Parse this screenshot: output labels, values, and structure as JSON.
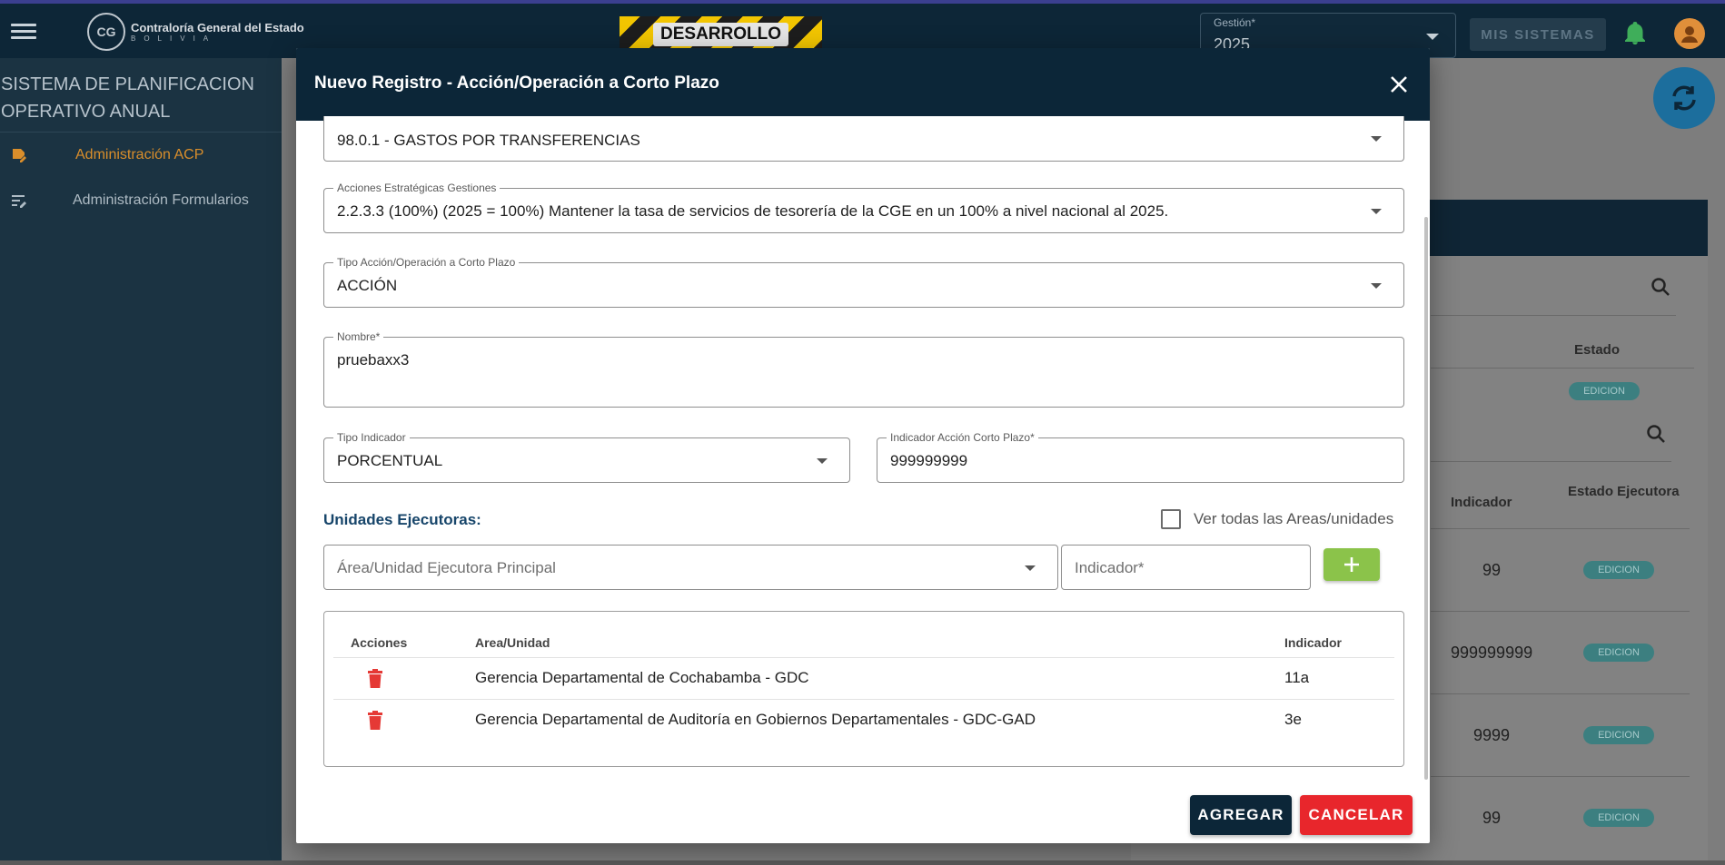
{
  "topbar": {
    "logo_text": "Contraloría General del Estado",
    "logo_sub": "BOLIVIA",
    "env_banner": "DESARROLLO",
    "gestion_label": "Gestión*",
    "gestion_value": "2025",
    "mis_sistemas": "MIS SISTEMAS"
  },
  "sidebar": {
    "system_title": "SISTEMA DE PLANIFICACION OPERATIVO ANUAL",
    "items": [
      {
        "label": "Administración ACP",
        "icon": "edit-document-icon",
        "active": true
      },
      {
        "label": "Administración Formularios",
        "icon": "list-edit-icon",
        "active": false
      }
    ]
  },
  "background_table": {
    "header_estado": "Estado",
    "estado_badge": "EDICION",
    "col_indicador": "Indicador",
    "col_estado_ejecutora": "Estado Ejecutora",
    "rows": [
      {
        "indicador": "99",
        "estado": "EDICION"
      },
      {
        "indicador": "999999999",
        "estado": "EDICION"
      },
      {
        "indicador": "9999",
        "estado": "EDICION"
      },
      {
        "indicador": "99",
        "estado": "EDICION"
      }
    ]
  },
  "modal": {
    "title": "Nuevo Registro - Acción/Operación a Corto Plazo",
    "fields": {
      "top_select_value": "98.0.1 - GASTOS POR TRANSFERENCIAS",
      "acciones_label": "Acciones Estratégicas Gestiones",
      "acciones_value": "2.2.3.3 (100%)  (2025 = 100%)   Mantener la tasa de servicios de tesorería de la CGE en un 100% a nivel nacional al 2025.",
      "tipo_accion_label": "Tipo Acción/Operación a Corto Plazo",
      "tipo_accion_value": "ACCIÓN",
      "nombre_label": "Nombre*",
      "nombre_value": "pruebaxx3",
      "tipo_indicador_label": "Tipo Indicador",
      "tipo_indicador_value": "PORCENTUAL",
      "indicador_acp_label": "Indicador Acción Corto Plazo*",
      "indicador_acp_value": "999999999"
    },
    "unidades": {
      "title": "Unidades Ejecutoras:",
      "ver_todas_label": "Ver todas las Areas/unidades",
      "area_placeholder": "Área/Unidad Ejecutora Principal",
      "indicador_placeholder": "Indicador*"
    },
    "table": {
      "headers": {
        "acciones": "Acciones",
        "area": "Area/Unidad",
        "indicador": "Indicador"
      },
      "rows": [
        {
          "area": "Gerencia Departamental de Cochabamba - GDC",
          "indicador": "11a"
        },
        {
          "area": "Gerencia Departamental de Auditoría en Gobiernos Departamentales - GDC-GAD",
          "indicador": "3e"
        }
      ]
    },
    "buttons": {
      "agregar": "AGREGAR",
      "cancelar": "CANCELAR"
    }
  },
  "colors": {
    "header_navy": "#0c2638",
    "accent_orange": "#d98e2b",
    "add_green": "#8bc34a",
    "cancel_red": "#e8262c",
    "trash_red": "#e53935"
  }
}
